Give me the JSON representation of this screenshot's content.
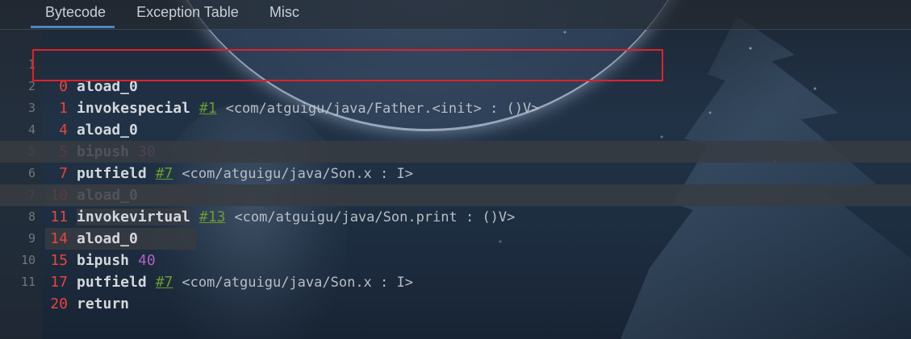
{
  "tabs": [
    {
      "label": "Bytecode",
      "active": true
    },
    {
      "label": "Exception Table",
      "active": false
    },
    {
      "label": "Misc",
      "active": false
    }
  ],
  "colors": {
    "offset": "#e8453c",
    "opcode": "#d3d7dd",
    "reference": "#6a9b2f",
    "number": "#b35fc4",
    "descriptor": "#b9bec6",
    "annotation_box": "#e0212b",
    "active_tab_underline": "#4a88c7"
  },
  "lines": [
    {
      "ln": "1",
      "offset": "0",
      "op": "aload_0",
      "ref": "",
      "num": "",
      "desc": "",
      "highlighted": false
    },
    {
      "ln": "2",
      "offset": "1",
      "op": "invokespecial",
      "ref": "#1",
      "num": "",
      "desc": "<com/atguigu/java/Father.<init> : ()V>",
      "highlighted": false
    },
    {
      "ln": "3",
      "offset": "4",
      "op": "aload_0",
      "ref": "",
      "num": "",
      "desc": "",
      "highlighted": false
    },
    {
      "ln": "4",
      "offset": "5",
      "op": "bipush",
      "ref": "",
      "num": "30",
      "desc": "",
      "highlighted": false
    },
    {
      "ln": "5",
      "offset": "7",
      "op": "putfield",
      "ref": "#7",
      "num": "",
      "desc": "<com/atguigu/java/Son.x : I>",
      "highlighted": false
    },
    {
      "ln": "6",
      "offset": "10",
      "op": "aload_0",
      "ref": "",
      "num": "",
      "desc": "",
      "highlighted": true
    },
    {
      "ln": "7",
      "offset": "11",
      "op": "invokevirtual",
      "ref": "#13",
      "num": "",
      "desc": "<com/atguigu/java/Son.print : ()V>",
      "highlighted": true
    },
    {
      "ln": "8",
      "offset": "14",
      "op": "aload_0",
      "ref": "",
      "num": "",
      "desc": "",
      "highlighted": true
    },
    {
      "ln": "9",
      "offset": "15",
      "op": "bipush",
      "ref": "",
      "num": "40",
      "desc": "",
      "highlighted": false
    },
    {
      "ln": "10",
      "offset": "17",
      "op": "putfield",
      "ref": "#7",
      "num": "",
      "desc": "<com/atguigu/java/Son.x : I>",
      "highlighted": false
    },
    {
      "ln": "11",
      "offset": "20",
      "op": "return",
      "ref": "",
      "num": "",
      "desc": "",
      "highlighted": false
    }
  ]
}
